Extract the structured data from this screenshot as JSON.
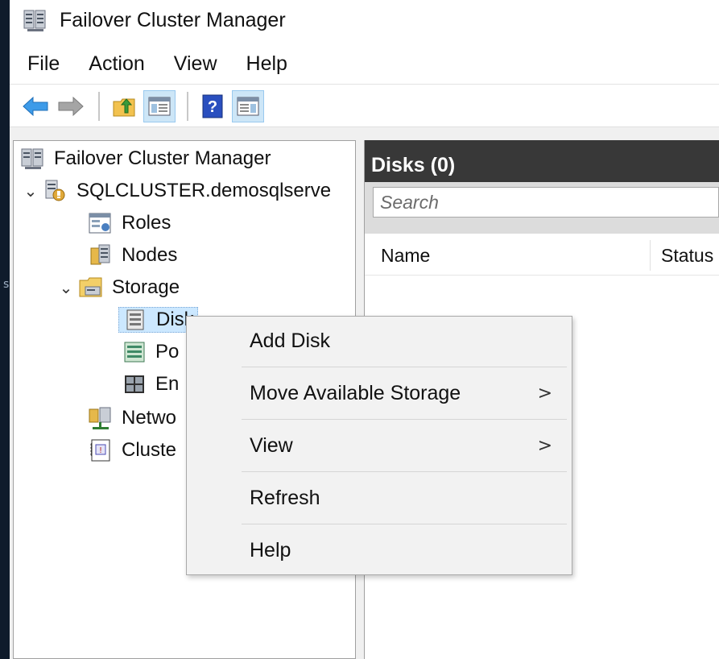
{
  "window": {
    "title": "Failover Cluster Manager"
  },
  "left_edge": {
    "mark": "s"
  },
  "menubar": {
    "items": [
      "File",
      "Action",
      "View",
      "Help"
    ]
  },
  "toolbar": {
    "buttons": [
      {
        "icon": "back-arrow-icon"
      },
      {
        "icon": "forward-arrow-icon"
      },
      {
        "icon": "up-folder-icon"
      },
      {
        "icon": "show-hide-console-tree-icon"
      },
      {
        "icon": "help-icon"
      },
      {
        "icon": "show-hide-action-pane-icon"
      }
    ]
  },
  "tree": {
    "root": "Failover Cluster Manager",
    "cluster": "SQLCLUSTER.demosqlserve",
    "roles": "Roles",
    "nodes": "Nodes",
    "storage": "Storage",
    "disks": "Disk",
    "pools": "Po",
    "enclosures": "En",
    "networks": "Netwo",
    "cluster_events": "Cluste"
  },
  "main": {
    "header": "Disks (0)",
    "search_placeholder": "Search",
    "columns": [
      "Name",
      "Status"
    ]
  },
  "context_menu": {
    "items": [
      {
        "label": "Add Disk",
        "submenu": false
      },
      {
        "label": "Move Available Storage",
        "submenu": true
      },
      {
        "label": "View",
        "submenu": true
      },
      {
        "label": "Refresh",
        "submenu": false
      },
      {
        "label": "Help",
        "submenu": false
      }
    ],
    "submenu_arrow": ">"
  },
  "colors": {
    "header_bg": "#383838",
    "selection_bg": "#cce8ff",
    "menu_bg": "#f2f2f2",
    "help_icon_blue": "#2a4fbf"
  }
}
